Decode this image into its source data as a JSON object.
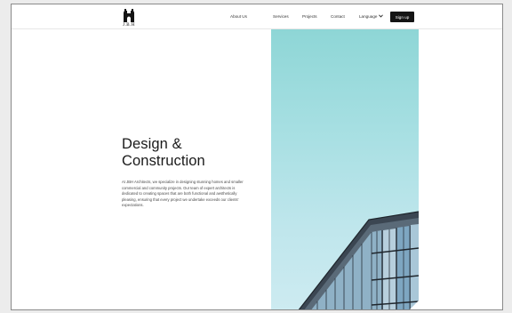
{
  "brand": {
    "logo_text": "J.B.H"
  },
  "nav": {
    "items": [
      {
        "label": "About Us"
      },
      {
        "label": "Services"
      },
      {
        "label": "Projects"
      },
      {
        "label": "Contact"
      }
    ],
    "language_label": "Language",
    "signup_label": "Sign up"
  },
  "hero": {
    "title_line1": "Design &",
    "title_line2": "Construction",
    "description": "At JBH Architects, we specialize in designing stunning homes and smaller commercial and community projects. Our team of expert architects is dedicated to creating spaces that are both functional and aesthetically pleasing, ensuring that every project we undertake exceeds our clients' expectations."
  },
  "icons": {
    "logo": "castle-logo-icon",
    "language_chevron": "chevron-down-icon"
  },
  "colors": {
    "primary_button": "#141414",
    "sky_top": "#8ed6d6",
    "sky_bottom": "#cdebf1"
  }
}
